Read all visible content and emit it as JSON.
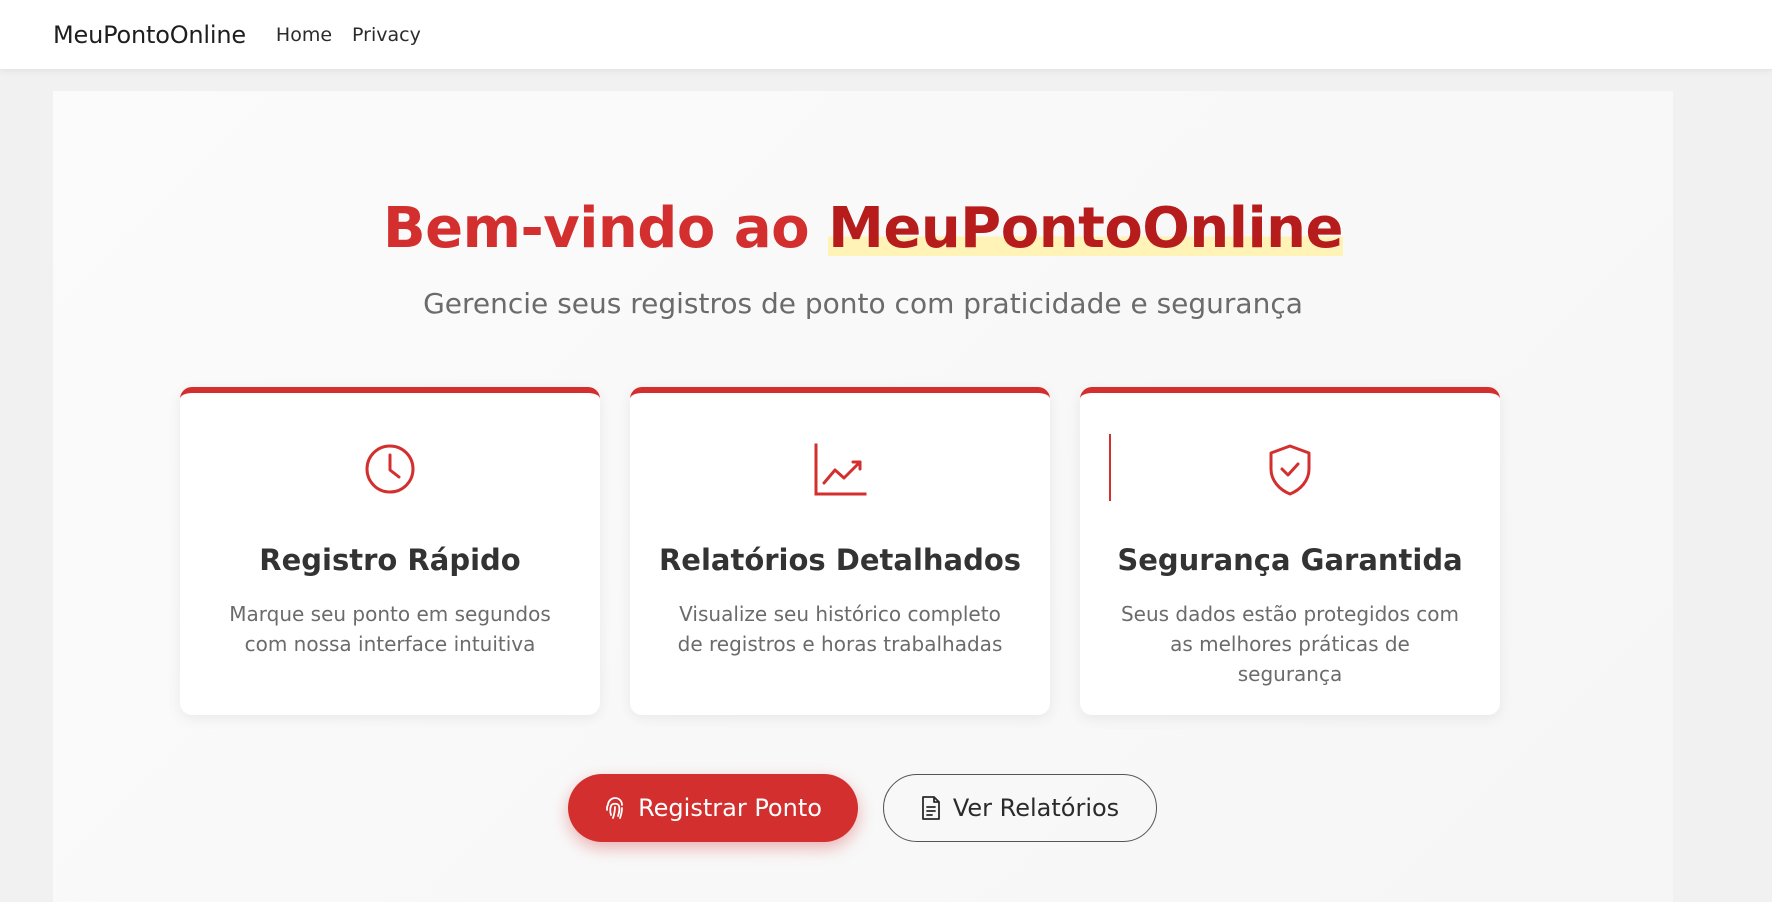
{
  "navbar": {
    "brand": "MeuPontoOnline",
    "links": [
      {
        "label": "Home"
      },
      {
        "label": "Privacy"
      }
    ]
  },
  "hero": {
    "title_prefix": "Bem-vindo ao ",
    "title_highlight": "MeuPontoOnline",
    "subtitle": "Gerencie seus registros de ponto com praticidade e segurança"
  },
  "features": [
    {
      "icon": "clock-icon",
      "title": "Registro Rápido",
      "text": "Marque seu ponto em segundos com nossa interface intuitiva"
    },
    {
      "icon": "chart-line-icon",
      "title": "Relatórios Detalhados",
      "text": "Visualize seu histórico completo de registros e horas trabalhadas"
    },
    {
      "icon": "shield-check-icon",
      "title": "Segurança Garantida",
      "text": "Seus dados estão protegidos com as melhores práticas de segurança"
    }
  ],
  "actions": {
    "primary": {
      "label": "Registrar Ponto",
      "icon": "fingerprint-icon"
    },
    "secondary": {
      "label": "Ver Relatórios",
      "icon": "document-icon"
    }
  },
  "colors": {
    "accent": "#d32f2f",
    "accent_dark": "#b71c1c",
    "highlight": "#fff3b8"
  }
}
